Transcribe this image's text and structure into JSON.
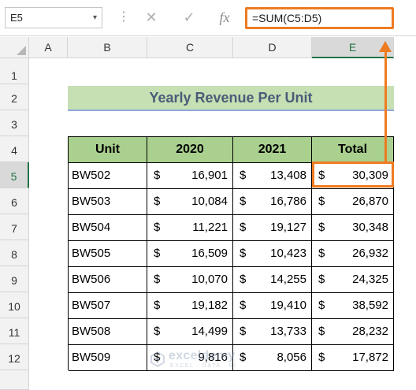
{
  "name_box": {
    "value": "E5"
  },
  "formula_bar": {
    "formula": "=SUM(C5:D5)",
    "cancel_glyph": "✕",
    "enter_glyph": "✓",
    "fx_glyph": "fx"
  },
  "columns": [
    "A",
    "B",
    "C",
    "D",
    "E"
  ],
  "selected_column": "E",
  "rows": [
    "1",
    "2",
    "3",
    "4",
    "5",
    "6",
    "7",
    "8",
    "9",
    "10",
    "11",
    "12"
  ],
  "selected_row": "5",
  "sheet": {
    "title": "Yearly Revenue Per Unit",
    "headers": [
      "Unit",
      "2020",
      "2021",
      "Total"
    ],
    "currency_symbol": "$",
    "data": [
      {
        "unit": "BW502",
        "y2020": "16,901",
        "y2021": "13,408",
        "total": "30,309"
      },
      {
        "unit": "BW503",
        "y2020": "10,084",
        "y2021": "16,786",
        "total": "26,870"
      },
      {
        "unit": "BW504",
        "y2020": "11,221",
        "y2021": "19,127",
        "total": "30,348"
      },
      {
        "unit": "BW505",
        "y2020": "16,509",
        "y2021": "10,423",
        "total": "26,932"
      },
      {
        "unit": "BW506",
        "y2020": "10,070",
        "y2021": "14,255",
        "total": "24,325"
      },
      {
        "unit": "BW507",
        "y2020": "19,182",
        "y2021": "19,410",
        "total": "38,592"
      },
      {
        "unit": "BW508",
        "y2020": "14,499",
        "y2021": "13,733",
        "total": "28,232"
      },
      {
        "unit": "BW509",
        "y2020": "9,816",
        "y2021": "8,056",
        "total": "17,872"
      }
    ]
  },
  "colors": {
    "accent_orange": "#ee7b22",
    "header_green": "#a9d08e",
    "title_green": "#c6e0b4",
    "title_text": "#4a5d78",
    "excel_green": "#217346"
  },
  "watermark": {
    "name": "exceldemy",
    "tagline": "EXCEL · DATA · BI"
  }
}
